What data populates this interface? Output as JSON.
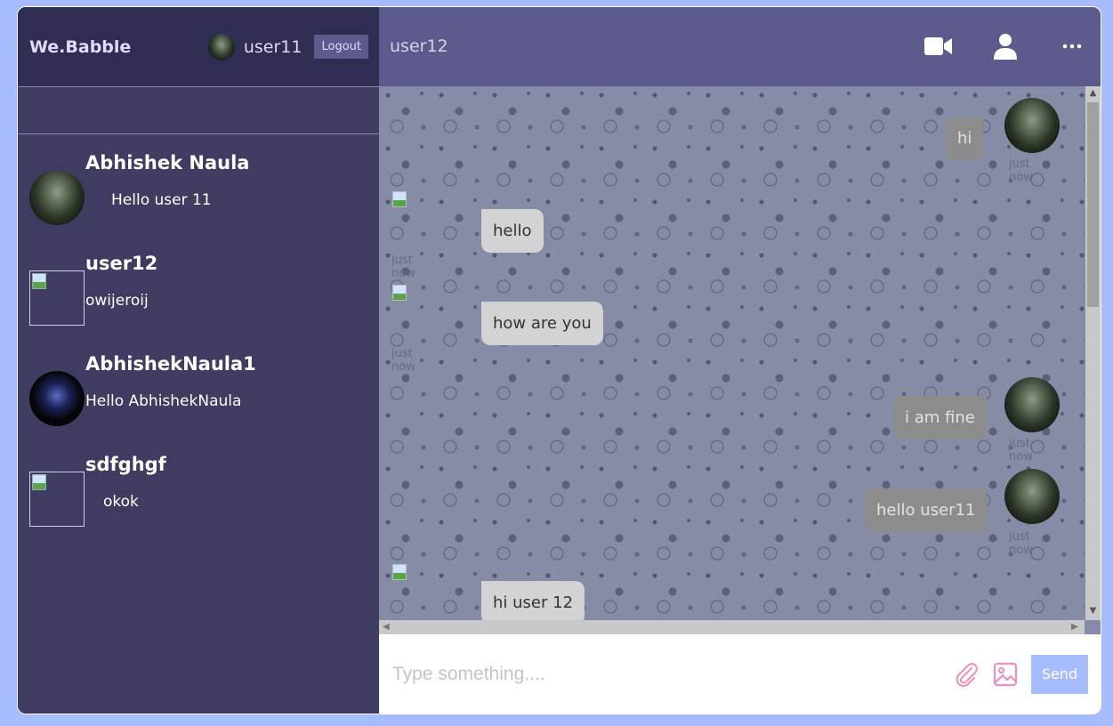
{
  "sidebar": {
    "logo": "We.Babble",
    "current_user": "user11",
    "logout_label": "Logout",
    "search_placeholder": "",
    "chats": [
      {
        "name": "Abhishek Naula",
        "last_message": "Hello user 11",
        "avatar": "forest-photo"
      },
      {
        "name": "user12",
        "last_message": "owijeroij",
        "avatar": "broken-image"
      },
      {
        "name": "AbhishekNaula1",
        "last_message": "Hello AbhishekNaula",
        "avatar": "wolf-photo"
      },
      {
        "name": "sdfghgf",
        "last_message": "okok",
        "avatar": "broken-image"
      }
    ]
  },
  "chat": {
    "peer_name": "user12",
    "header_icons": [
      "video-camera-icon",
      "user-profile-icon",
      "more-options-icon"
    ],
    "messages": [
      {
        "text": "hi",
        "owner": "mine",
        "time": "just now"
      },
      {
        "text": "hello",
        "owner": "theirs",
        "time": "just now"
      },
      {
        "text": "how are you",
        "owner": "theirs",
        "time": "just now"
      },
      {
        "text": "i am fine",
        "owner": "mine",
        "time": "just now"
      },
      {
        "text": "hello user11",
        "owner": "mine",
        "time": "just now"
      },
      {
        "text": "hi user 12",
        "owner": "theirs",
        "time": ""
      }
    ],
    "input_placeholder": "Type something....",
    "send_label": "Send"
  },
  "colors": {
    "page_bg": "#a7bcff",
    "sidebar_bg": "#3e3c61",
    "sidebar_header_bg": "#2f2d52",
    "chat_header_bg": "#5d5b8d",
    "send_button_bg": "#a7bcff",
    "input_icon": "#f08fc0"
  }
}
